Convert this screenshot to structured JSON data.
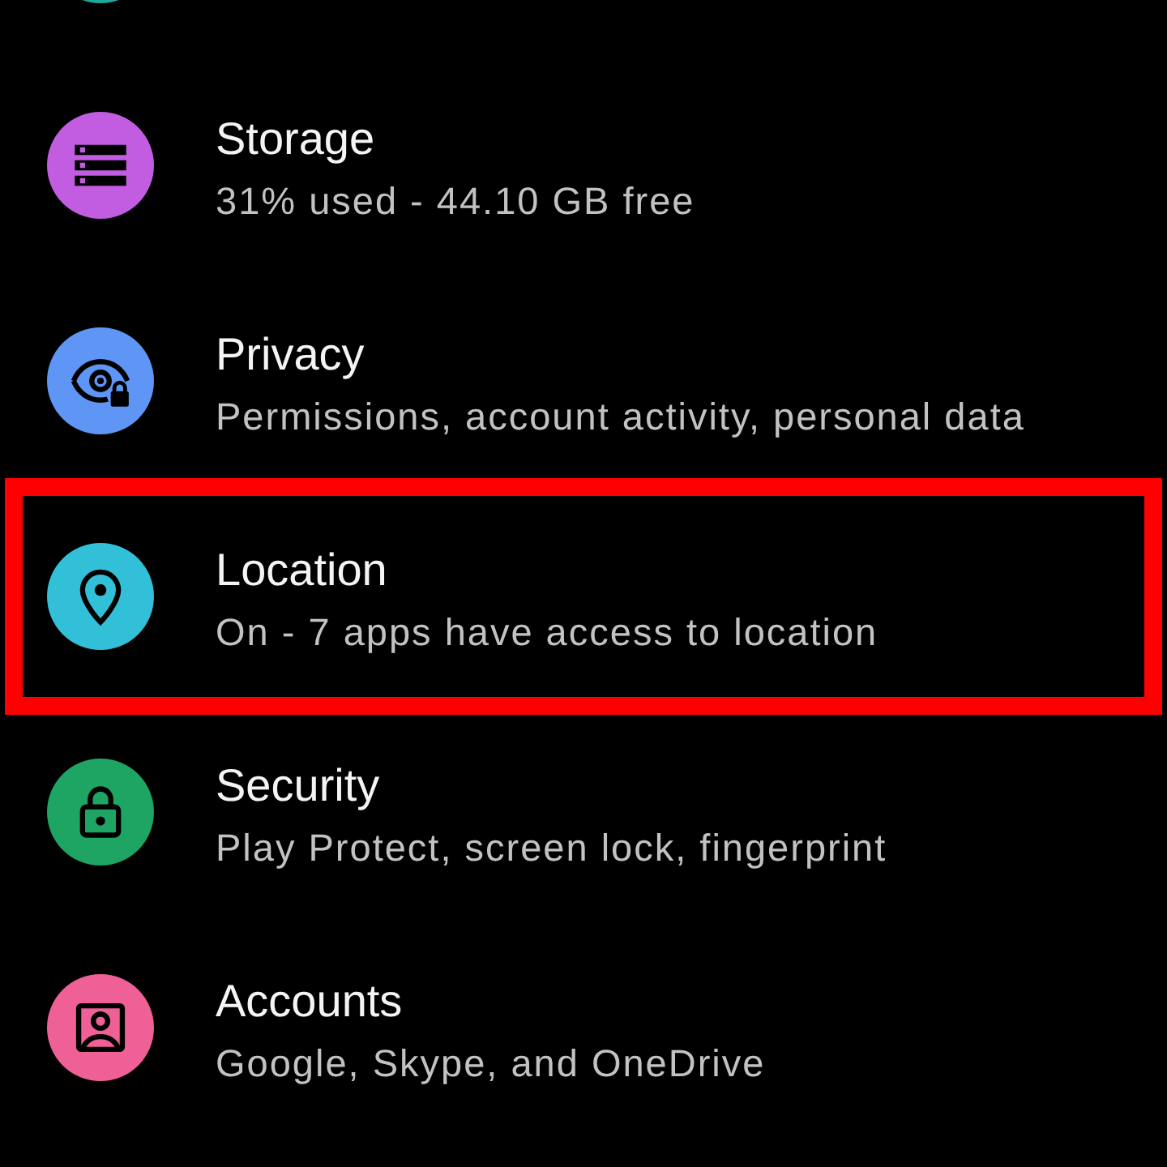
{
  "items": [
    {
      "kind": "partial",
      "color": "#1fa99a",
      "highlighted": false
    },
    {
      "kind": "storage",
      "title": "Storage",
      "summary": "31% used - 44.10 GB free",
      "color": "#c25ce0",
      "highlighted": false
    },
    {
      "kind": "privacy",
      "title": "Privacy",
      "summary": "Permissions, account activity, personal data",
      "color": "#5f96f5",
      "highlighted": false
    },
    {
      "kind": "location",
      "title": "Location",
      "summary": "On - 7 apps have access to location",
      "color": "#32c0d9",
      "highlighted": true
    },
    {
      "kind": "security",
      "title": "Security",
      "summary": "Play Protect, screen lock, fingerprint",
      "color": "#1ea463",
      "highlighted": false
    },
    {
      "kind": "accounts",
      "title": "Accounts",
      "summary": "Google, Skype, and OneDrive",
      "color": "#ef6096",
      "highlighted": false
    }
  ]
}
